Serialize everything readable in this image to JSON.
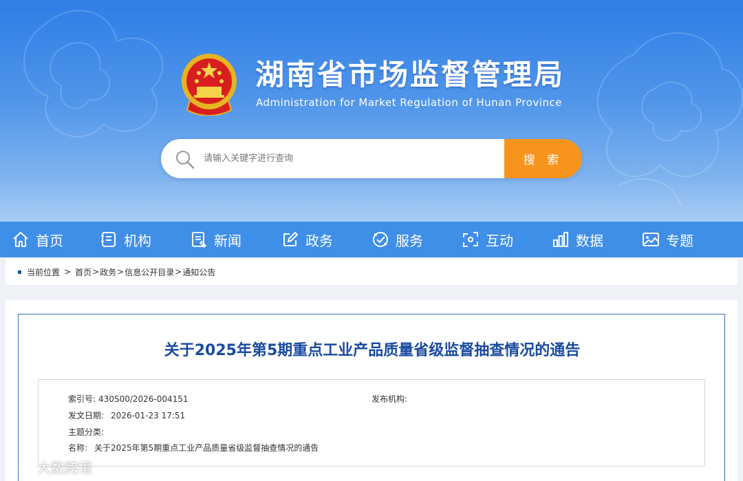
{
  "header": {
    "title": "湖南省市场监督管理局",
    "subtitle": "Administration for Market Regulation of Hunan Province"
  },
  "search": {
    "placeholder": "请输入关键字进行查询",
    "button_label": "搜 索"
  },
  "nav": {
    "items": [
      {
        "label": "首页",
        "icon": "home-icon"
      },
      {
        "label": "机构",
        "icon": "document-icon"
      },
      {
        "label": "新闻",
        "icon": "news-icon"
      },
      {
        "label": "政务",
        "icon": "edit-icon"
      },
      {
        "label": "服务",
        "icon": "service-icon"
      },
      {
        "label": "互动",
        "icon": "interaction-icon"
      },
      {
        "label": "数据",
        "icon": "bar-chart-icon"
      },
      {
        "label": "专题",
        "icon": "image-icon"
      }
    ]
  },
  "breadcrumb": {
    "current_label": "当前位置",
    "separator": ">",
    "items": [
      "首页",
      "政务",
      "信息公开目录",
      "通知公告"
    ],
    "inner_separator": ">"
  },
  "article": {
    "title": "关于2025年第5期重点工业产品质量省级监督抽查情况的通告",
    "meta": {
      "index_label": "索引号:",
      "index_value": "430S00/2026-004151",
      "publisher_label": "发布机构:",
      "publisher_value": "",
      "date_label": "发文日期:",
      "date_value": "2026-01-23 17:51",
      "topic_label": "主题分类:",
      "topic_value": "",
      "name_label": "名称:",
      "name_value": "关于2025年第5期重点工业产品质量省级监督抽查情况的通告"
    }
  },
  "watermark": {
    "text": "大数跨境"
  },
  "colors": {
    "nav_bg": "#3f8ee8",
    "search_button": "#f7941d",
    "title_blue": "#1a4aa0"
  }
}
